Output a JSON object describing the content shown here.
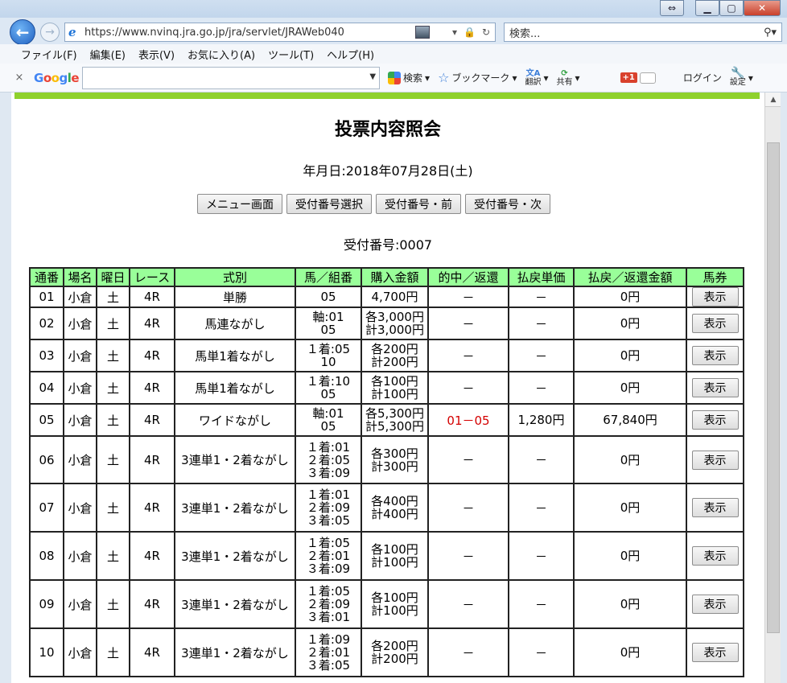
{
  "browser": {
    "url": "https://www.nvinq.jra.go.jp/jra/servlet/JRAWeb040",
    "search_placeholder": "検索...",
    "menu": [
      "ファイル(F)",
      "編集(E)",
      "表示(V)",
      "お気に入り(A)",
      "ツール(T)",
      "ヘルプ(H)"
    ],
    "google_toolbar": {
      "search_label": "検索",
      "bookmark_label": "ブックマーク",
      "translate_label": "翻訳",
      "share_label": "共有",
      "login_label": "ログイン",
      "settings_label": "設定",
      "gplus": "+1"
    }
  },
  "page": {
    "title": "投票内容照会",
    "date_text": "年月日:2018年07月28日(土)",
    "buttons": [
      "メニュー画面",
      "受付番号選択",
      "受付番号・前",
      "受付番号・次"
    ],
    "receipt_text": "受付番号:0007",
    "columns": [
      "通番",
      "場名",
      "曜日",
      "レース",
      "式別",
      "馬／組番",
      "購入金額",
      "的中／返還",
      "払戻単価",
      "払戻／返還金額",
      "馬券"
    ],
    "view_label": "表示",
    "rows": [
      {
        "no": "01",
        "venue": "小倉",
        "day": "土",
        "race": "4R",
        "type": "単勝",
        "combo": [
          "05"
        ],
        "amount": [
          "4,700円"
        ],
        "hit": "－",
        "unit": "－",
        "payout": "0円",
        "hit_red": false
      },
      {
        "no": "02",
        "venue": "小倉",
        "day": "土",
        "race": "4R",
        "type": "馬連ながし",
        "combo": [
          "軸:01",
          "05"
        ],
        "amount": [
          "各3,000円",
          "計3,000円"
        ],
        "hit": "－",
        "unit": "－",
        "payout": "0円",
        "hit_red": false
      },
      {
        "no": "03",
        "venue": "小倉",
        "day": "土",
        "race": "4R",
        "type": "馬単1着ながし",
        "combo": [
          "１着:05",
          "10"
        ],
        "amount": [
          "各200円",
          "計200円"
        ],
        "hit": "－",
        "unit": "－",
        "payout": "0円",
        "hit_red": false
      },
      {
        "no": "04",
        "venue": "小倉",
        "day": "土",
        "race": "4R",
        "type": "馬単1着ながし",
        "combo": [
          "１着:10",
          "05"
        ],
        "amount": [
          "各100円",
          "計100円"
        ],
        "hit": "－",
        "unit": "－",
        "payout": "0円",
        "hit_red": false
      },
      {
        "no": "05",
        "venue": "小倉",
        "day": "土",
        "race": "4R",
        "type": "ワイドながし",
        "combo": [
          "軸:01",
          "05"
        ],
        "amount": [
          "各5,300円",
          "計5,300円"
        ],
        "hit": "01－05",
        "unit": "1,280円",
        "payout": "67,840円",
        "hit_red": true
      },
      {
        "no": "06",
        "venue": "小倉",
        "day": "土",
        "race": "4R",
        "type": "3連単1・2着ながし",
        "combo": [
          "１着:01",
          "２着:05",
          "３着:09"
        ],
        "amount": [
          "各300円",
          "計300円"
        ],
        "hit": "－",
        "unit": "－",
        "payout": "0円",
        "hit_red": false
      },
      {
        "no": "07",
        "venue": "小倉",
        "day": "土",
        "race": "4R",
        "type": "3連単1・2着ながし",
        "combo": [
          "１着:01",
          "２着:09",
          "３着:05"
        ],
        "amount": [
          "各400円",
          "計400円"
        ],
        "hit": "－",
        "unit": "－",
        "payout": "0円",
        "hit_red": false
      },
      {
        "no": "08",
        "venue": "小倉",
        "day": "土",
        "race": "4R",
        "type": "3連単1・2着ながし",
        "combo": [
          "１着:05",
          "２着:01",
          "３着:09"
        ],
        "amount": [
          "各100円",
          "計100円"
        ],
        "hit": "－",
        "unit": "－",
        "payout": "0円",
        "hit_red": false
      },
      {
        "no": "09",
        "venue": "小倉",
        "day": "土",
        "race": "4R",
        "type": "3連単1・2着ながし",
        "combo": [
          "１着:05",
          "２着:09",
          "３着:01"
        ],
        "amount": [
          "各100円",
          "計100円"
        ],
        "hit": "－",
        "unit": "－",
        "payout": "0円",
        "hit_red": false
      },
      {
        "no": "10",
        "venue": "小倉",
        "day": "土",
        "race": "4R",
        "type": "3連単1・2着ながし",
        "combo": [
          "１着:09",
          "２着:01",
          "３着:05"
        ],
        "amount": [
          "各200円",
          "計200円"
        ],
        "hit": "－",
        "unit": "－",
        "payout": "0円",
        "hit_red": false
      }
    ]
  }
}
